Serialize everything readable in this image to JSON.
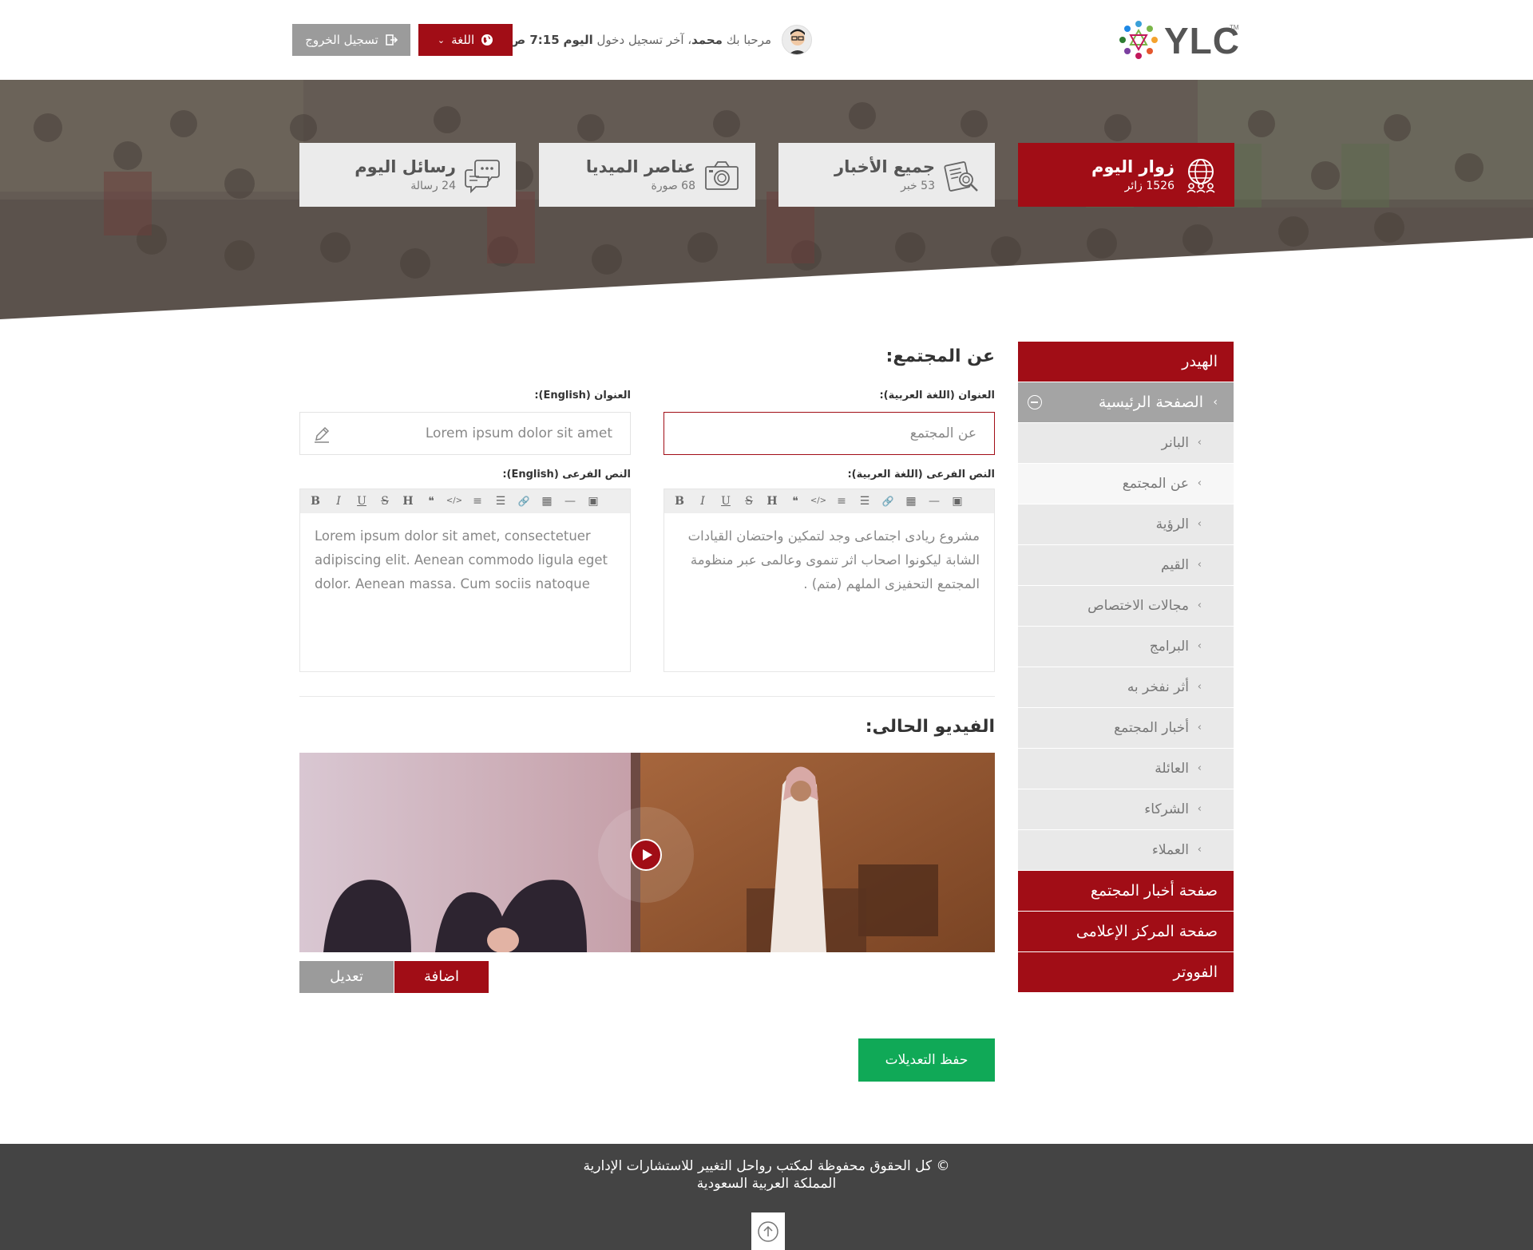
{
  "header": {
    "logo_text": "YLC",
    "logo_tm": "TM",
    "welcome_prefix": "مرحبا بك",
    "user_name": "محمد",
    "last_login_label": "، آخر تسجيل دخول",
    "last_login_day": "اليوم",
    "last_login_time": "7:15 ص",
    "lang_button": "اللغة",
    "logout_button": "تسجيل الخروج"
  },
  "stats": [
    {
      "title": "زوار اليوم",
      "sub": "1526 زائر",
      "icon": "globe-people-icon",
      "active": true
    },
    {
      "title": "جميع الأخبار",
      "sub": "53 خبر",
      "icon": "news-search-icon",
      "active": false
    },
    {
      "title": "عناصر الميديا",
      "sub": "68 صورة",
      "icon": "camera-icon",
      "active": false
    },
    {
      "title": "رسائل اليوم",
      "sub": "24 رسالة",
      "icon": "chat-bubbles-icon",
      "active": false
    }
  ],
  "sidebar": {
    "header_item": "الهيدر",
    "home_item": "الصفحة الرئيسية",
    "sub_items": [
      "البانر",
      "عن المجتمع",
      "الرؤية",
      "القيم",
      "مجالات الاختصاص",
      "البرامج",
      "أثر نفخر به",
      "أخبار المجتمع",
      "العائلة",
      "الشركاء",
      "العملاء"
    ],
    "current_sub": "عن المجتمع",
    "community_news_page": "صفحة أخبار المجتمع",
    "media_center_page": "صفحة المركز الإعلامى",
    "footer_item": "الفووتر"
  },
  "form": {
    "section_title": "عن المجتمع:",
    "title_ar_label": "العنوان (اللغة العربية):",
    "title_ar_value": "عن المجتمع",
    "title_en_label": "العنوان (English):",
    "title_en_value": "Lorem ipsum dolor sit amet",
    "sub_ar_label": "النص الفرعى (اللغة العربية):",
    "sub_ar_value": "مشروع ريادى اجتماعى وجد لتمكين واحتضان القيادات الشابة ليكونوا اصحاب اثر تنموى وعالمى عبر منظومة المجتمع التحفيزى الملهم (متم) .",
    "sub_en_label": "النص الفرعى (English):",
    "sub_en_value": "Lorem ipsum dolor sit amet, consectetuer adipiscing elit. Aenean commodo ligula eget dolor. Aenean massa. Cum sociis natoque",
    "toolbar": [
      "B",
      "I",
      "U",
      "S",
      "H",
      "❝",
      "</>",
      "≡",
      "☰",
      "🔗",
      "▦",
      "—",
      "▣"
    ],
    "video_title": "الفيديو الحالى:",
    "add_button": "اضافة",
    "edit_button": "تعديل",
    "save_button": "حفظ التعديلات"
  },
  "footer": {
    "copyright": "© كل الحقوق محفوظة لمكتب رواحل التغيير للاستشارات الإدارية",
    "country": "المملكة العربية السعودية"
  },
  "colors": {
    "accent": "#a10d16",
    "grey_button": "#9b9b9b",
    "save_green": "#10a957",
    "footer_bg": "#444444"
  }
}
